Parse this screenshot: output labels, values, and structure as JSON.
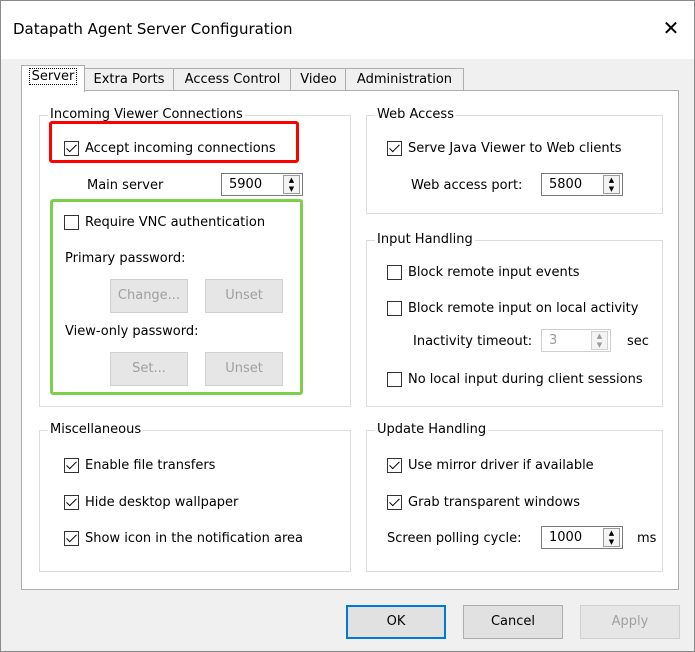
{
  "window": {
    "title": "Datapath Agent Server Configuration",
    "close_glyph": "✕"
  },
  "tabs": [
    {
      "label": "Server",
      "active": true
    },
    {
      "label": "Extra Ports"
    },
    {
      "label": "Access Control"
    },
    {
      "label": "Video"
    },
    {
      "label": "Administration"
    }
  ],
  "incoming": {
    "title": "Incoming Viewer Connections",
    "accept_label": "Accept incoming connections",
    "accept_checked": true,
    "main_server_label": "Main server",
    "main_server_value": "5900",
    "require_vnc_label": "Require VNC authentication",
    "require_vnc_checked": false,
    "primary_password_label": "Primary password:",
    "change_button": "Change...",
    "unset_button_1": "Unset",
    "view_only_label": "View-only password:",
    "set_button": "Set...",
    "unset_button_2": "Unset"
  },
  "web_access": {
    "title": "Web Access",
    "serve_java_label": "Serve Java Viewer to Web clients",
    "serve_java_checked": true,
    "port_label": "Web access port:",
    "port_value": "5800"
  },
  "input_handling": {
    "title": "Input Handling",
    "block_remote_label": "Block remote input events",
    "block_local_label": "Block remote input on local activity",
    "inactivity_label": "Inactivity timeout:",
    "inactivity_value": "3",
    "inactivity_unit": "sec",
    "no_local_label": "No local input during client sessions"
  },
  "misc": {
    "title": "Miscellaneous",
    "file_transfers_label": "Enable file transfers",
    "hide_wallpaper_label": "Hide desktop wallpaper",
    "show_icon_label": "Show icon in the notification area"
  },
  "update_handling": {
    "title": "Update Handling",
    "mirror_driver_label": "Use mirror driver if available",
    "grab_transparent_label": "Grab transparent windows",
    "polling_label": "Screen polling cycle:",
    "polling_value": "1000",
    "polling_unit": "ms"
  },
  "buttons": {
    "ok": "OK",
    "cancel": "Cancel",
    "apply": "Apply"
  },
  "highlights": {
    "red": "#ff0000",
    "green": "#7dd14a",
    "focus_blue": "#0078d7"
  }
}
